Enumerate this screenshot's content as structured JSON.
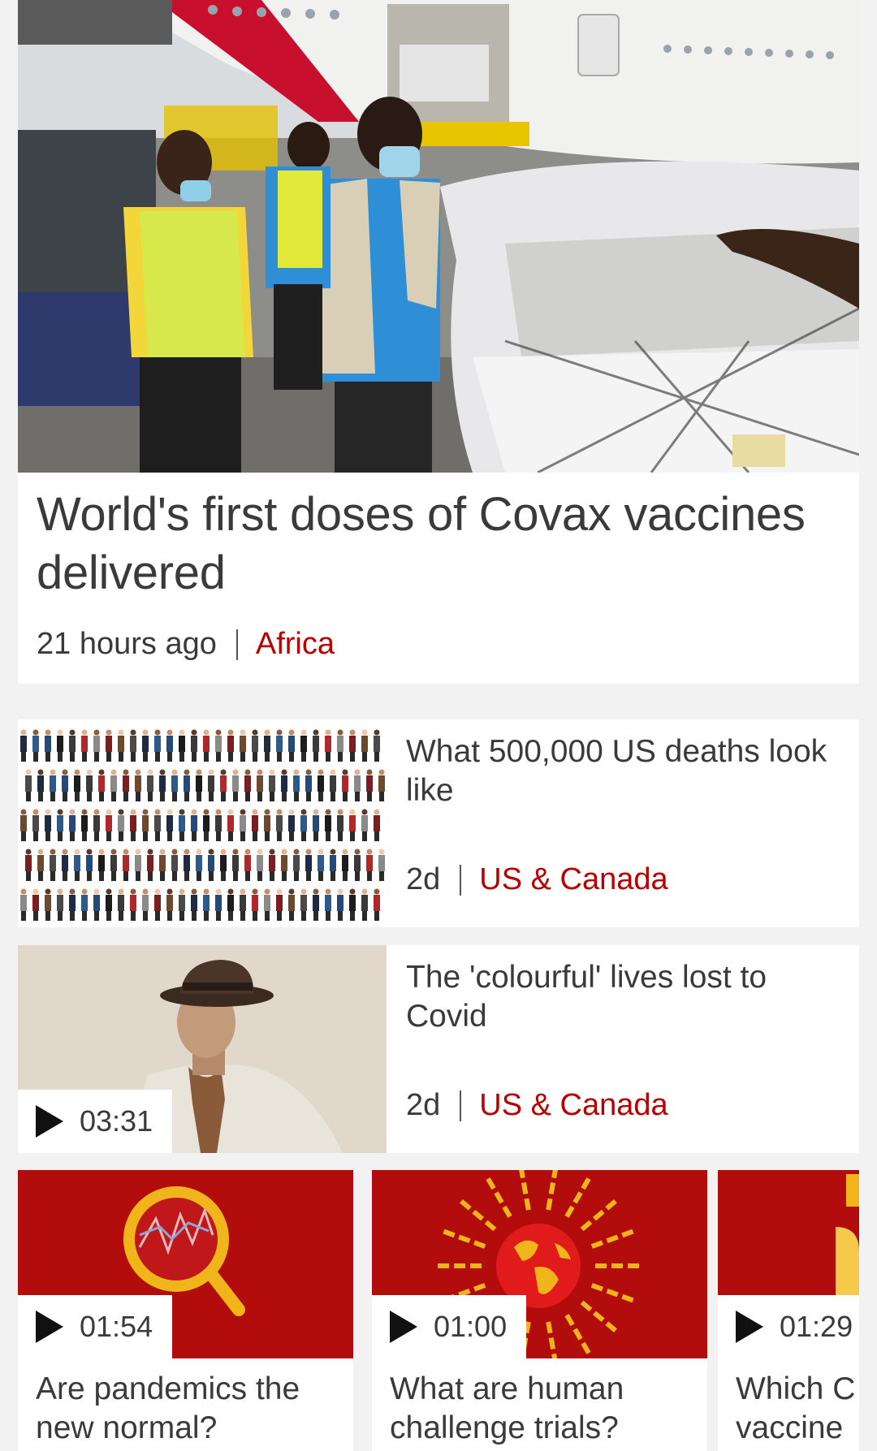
{
  "hero": {
    "title": "World's first doses of Covax vaccines delivered",
    "time": "21 hours ago",
    "category": "Africa"
  },
  "rows": [
    {
      "title": "What 500,000 US deaths look like",
      "time": "2d",
      "category": "US & Canada"
    },
    {
      "title": "The 'colourful' lives lost to Covid",
      "time": "2d",
      "category": "US & Canada",
      "duration": "03:31"
    }
  ],
  "cards": [
    {
      "title_line1": "Are pandemics the",
      "title_line2": "new normal?",
      "duration": "01:54"
    },
    {
      "title_line1": "What are human",
      "title_line2": "challenge trials?",
      "duration": "01:00"
    },
    {
      "title_line1": "Which C",
      "title_line2": "vaccine",
      "duration": "01:29"
    }
  ],
  "colors": {
    "accent": "#b80000",
    "text": "#3a3a3a",
    "background": "#f2f2f2"
  }
}
